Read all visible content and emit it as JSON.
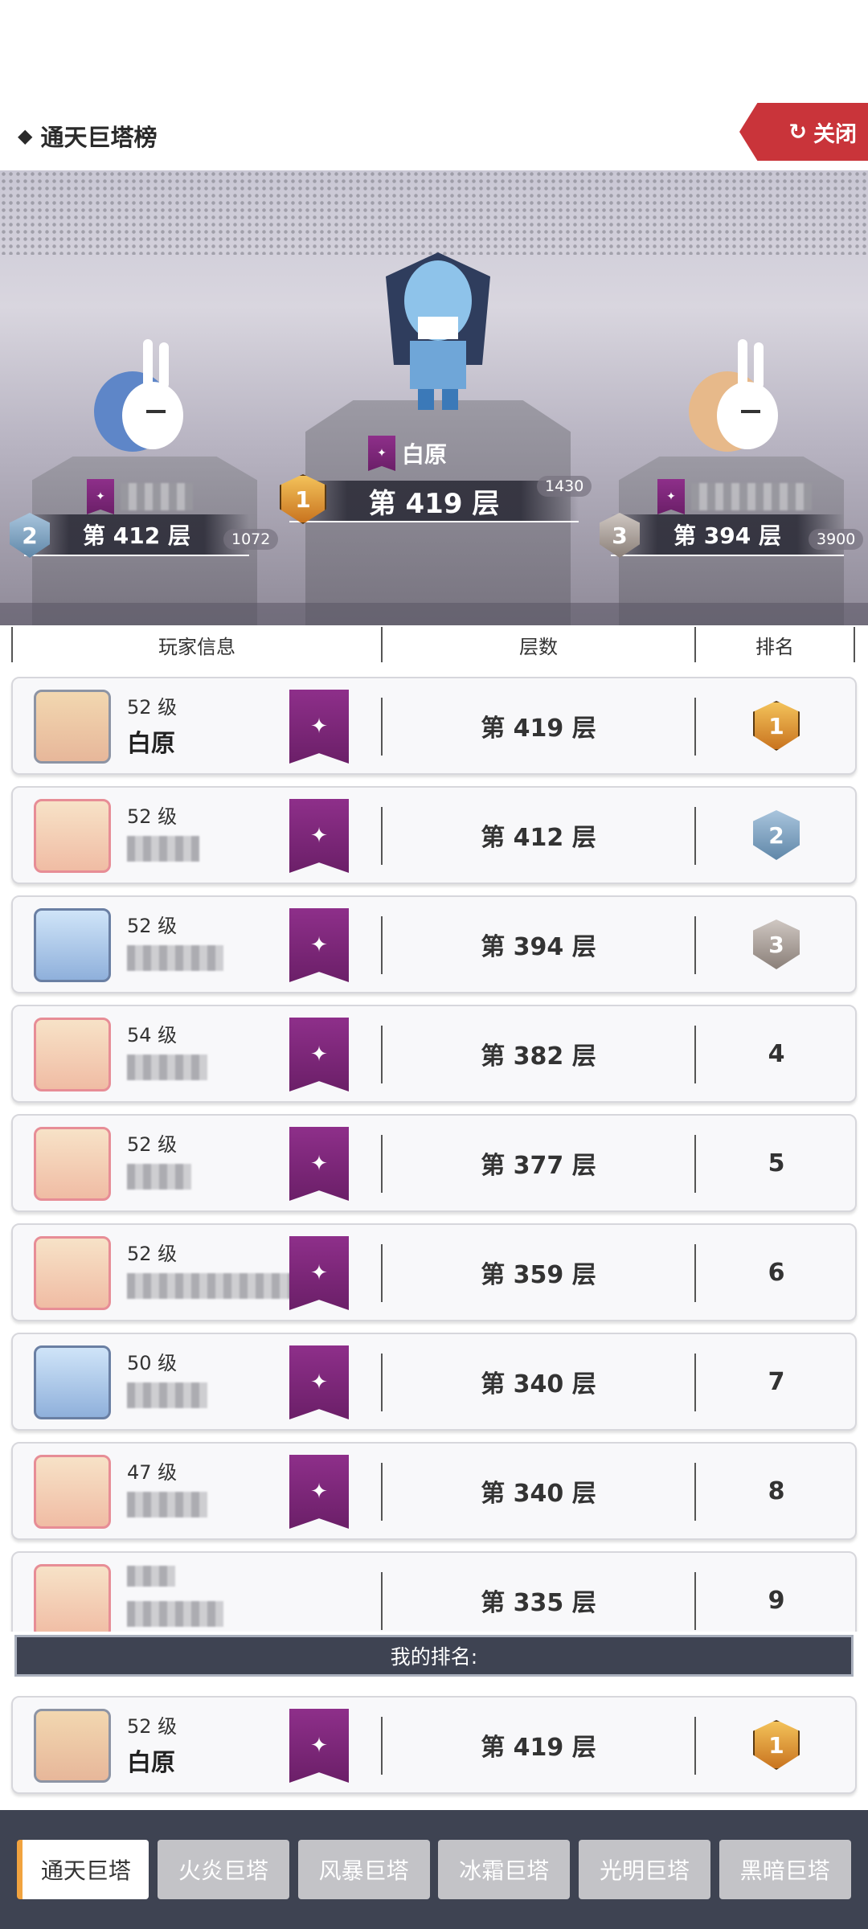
{
  "header": {
    "title": "通天巨塔榜",
    "close_label": "关闭"
  },
  "podium": {
    "first": {
      "name": "白原",
      "floor": "第 419 层",
      "score": "1430",
      "medal": "1"
    },
    "second": {
      "floor": "第 412 层",
      "score": "1072",
      "medal": "2"
    },
    "third": {
      "floor": "第 394 层",
      "score": "3900",
      "medal": "3"
    }
  },
  "columns": {
    "player": "玩家信息",
    "floor": "层数",
    "rank": "排名"
  },
  "rows": [
    {
      "level": "52 级",
      "name": "白原",
      "floor": "第 419 层",
      "rank": "1",
      "medal": true
    },
    {
      "level": "52 级",
      "name": "",
      "floor": "第 412 层",
      "rank": "2",
      "medal": true
    },
    {
      "level": "52 级",
      "name": "",
      "floor": "第 394 层",
      "rank": "3",
      "medal": true
    },
    {
      "level": "54 级",
      "name": "",
      "floor": "第 382 层",
      "rank": "4",
      "medal": false
    },
    {
      "level": "52 级",
      "name": "",
      "floor": "第 377 层",
      "rank": "5",
      "medal": false
    },
    {
      "level": "52 级",
      "name": "",
      "floor": "第 359 层",
      "rank": "6",
      "medal": false
    },
    {
      "level": "50 级",
      "name": "",
      "floor": "第 340 层",
      "rank": "7",
      "medal": false
    },
    {
      "level": "47 级",
      "name": "",
      "floor": "第 340 层",
      "rank": "8",
      "medal": false
    },
    {
      "level": "",
      "name": "",
      "floor": "第 335 层",
      "rank": "9",
      "medal": false
    }
  ],
  "my_rank": {
    "label": "我的排名:",
    "level": "52 级",
    "name": "白原",
    "floor": "第 419 层",
    "rank": "1"
  },
  "tabs": [
    "通天巨塔",
    "火炎巨塔",
    "风暴巨塔",
    "冰霜巨塔",
    "光明巨塔",
    "黑暗巨塔"
  ]
}
